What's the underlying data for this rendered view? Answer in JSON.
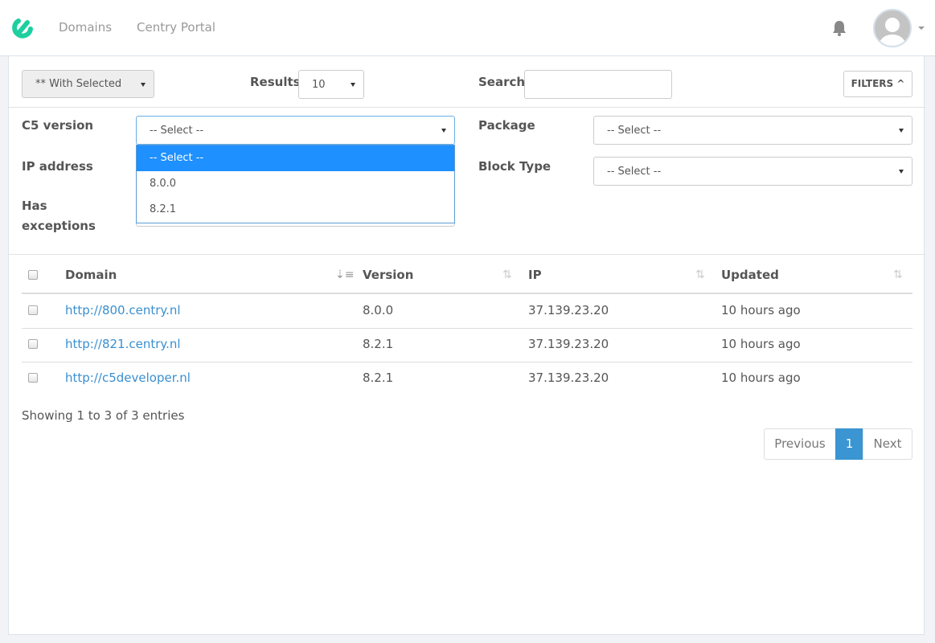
{
  "nav": {
    "links": [
      "Domains",
      "Centry Portal"
    ],
    "brand_color": "#1ecfa0"
  },
  "toolbar": {
    "with_selected": "** With Selected",
    "results_label": "Results",
    "results_value": "10",
    "search_label": "Search",
    "search_value": "",
    "filters_button": "FILTERS ^"
  },
  "filters": {
    "c5_version_label": "C5 version",
    "c5_version_value": "-- Select --",
    "c5_options": [
      "-- Select --",
      "8.0.0",
      "8.2.1"
    ],
    "ip_label": "IP address",
    "exceptions_label": "Has exceptions",
    "package_label": "Package",
    "package_value": "-- Select --",
    "block_type_label": "Block Type",
    "block_type_value": "-- Select --"
  },
  "table": {
    "headers": [
      "Domain",
      "Version",
      "IP",
      "Updated"
    ],
    "rows": [
      [
        "http://800.centry.nl",
        "8.0.0",
        "37.139.23.20",
        "10 hours ago"
      ],
      [
        "http://821.centry.nl",
        "8.2.1",
        "37.139.23.20",
        "10 hours ago"
      ],
      [
        "http://c5developer.nl",
        "8.2.1",
        "37.139.23.20",
        "10 hours ago"
      ]
    ]
  },
  "footer": {
    "info": "Showing 1 to 3 of 3 entries",
    "previous": "Previous",
    "page": "1",
    "next": "Next"
  }
}
